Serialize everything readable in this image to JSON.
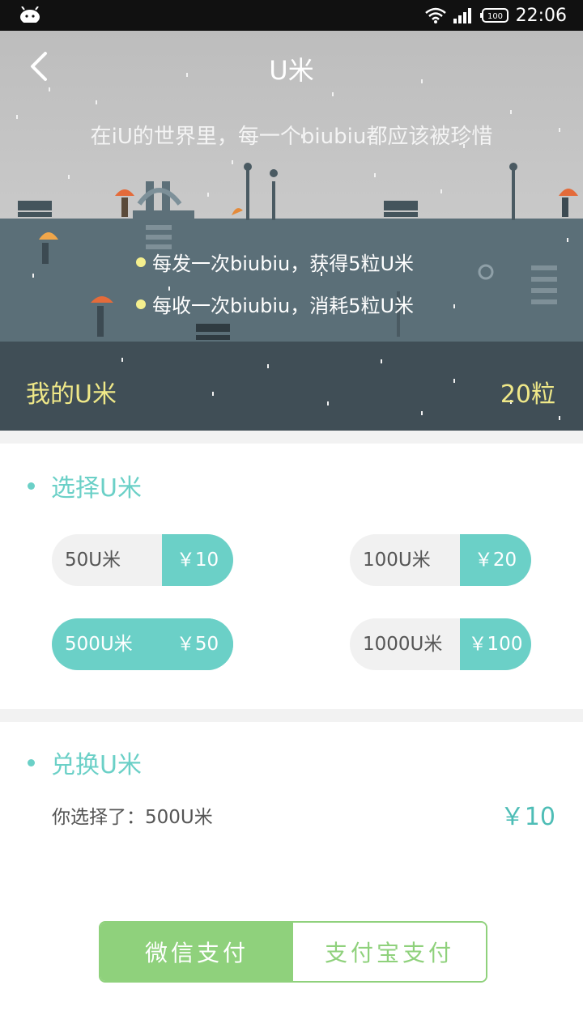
{
  "status_bar": {
    "time": "22:06",
    "battery": "100"
  },
  "header": {
    "title": "U米",
    "back_icon": "chevron-left-icon"
  },
  "hero": {
    "slogan": "在iU的世界里，每一个biubiu都应该被珍惜",
    "rules": [
      "每发一次biubiu，获得5粒U米",
      "每收一次biubiu，消耗5粒U米"
    ],
    "my_label": "我的U米",
    "my_value": "20粒"
  },
  "choose_section": {
    "title": "选择U米",
    "options": [
      {
        "amount": "50U米",
        "price": "￥10",
        "selected": false
      },
      {
        "amount": "100U米",
        "price": "￥20",
        "selected": false
      },
      {
        "amount": "500U米",
        "price": "￥50",
        "selected": true
      },
      {
        "amount": "1000U米",
        "price": "￥100",
        "selected": false
      }
    ]
  },
  "exchange_section": {
    "title": "兑换U米",
    "chosen_label": "你选择了：500U米",
    "chosen_price": "￥10"
  },
  "payment": {
    "wechat_label": "微信支付",
    "alipay_label": "支付宝支付"
  },
  "colors": {
    "accent": "#6bd0c7",
    "pay_green": "#8fd17c",
    "hero_text": "#efe888"
  }
}
